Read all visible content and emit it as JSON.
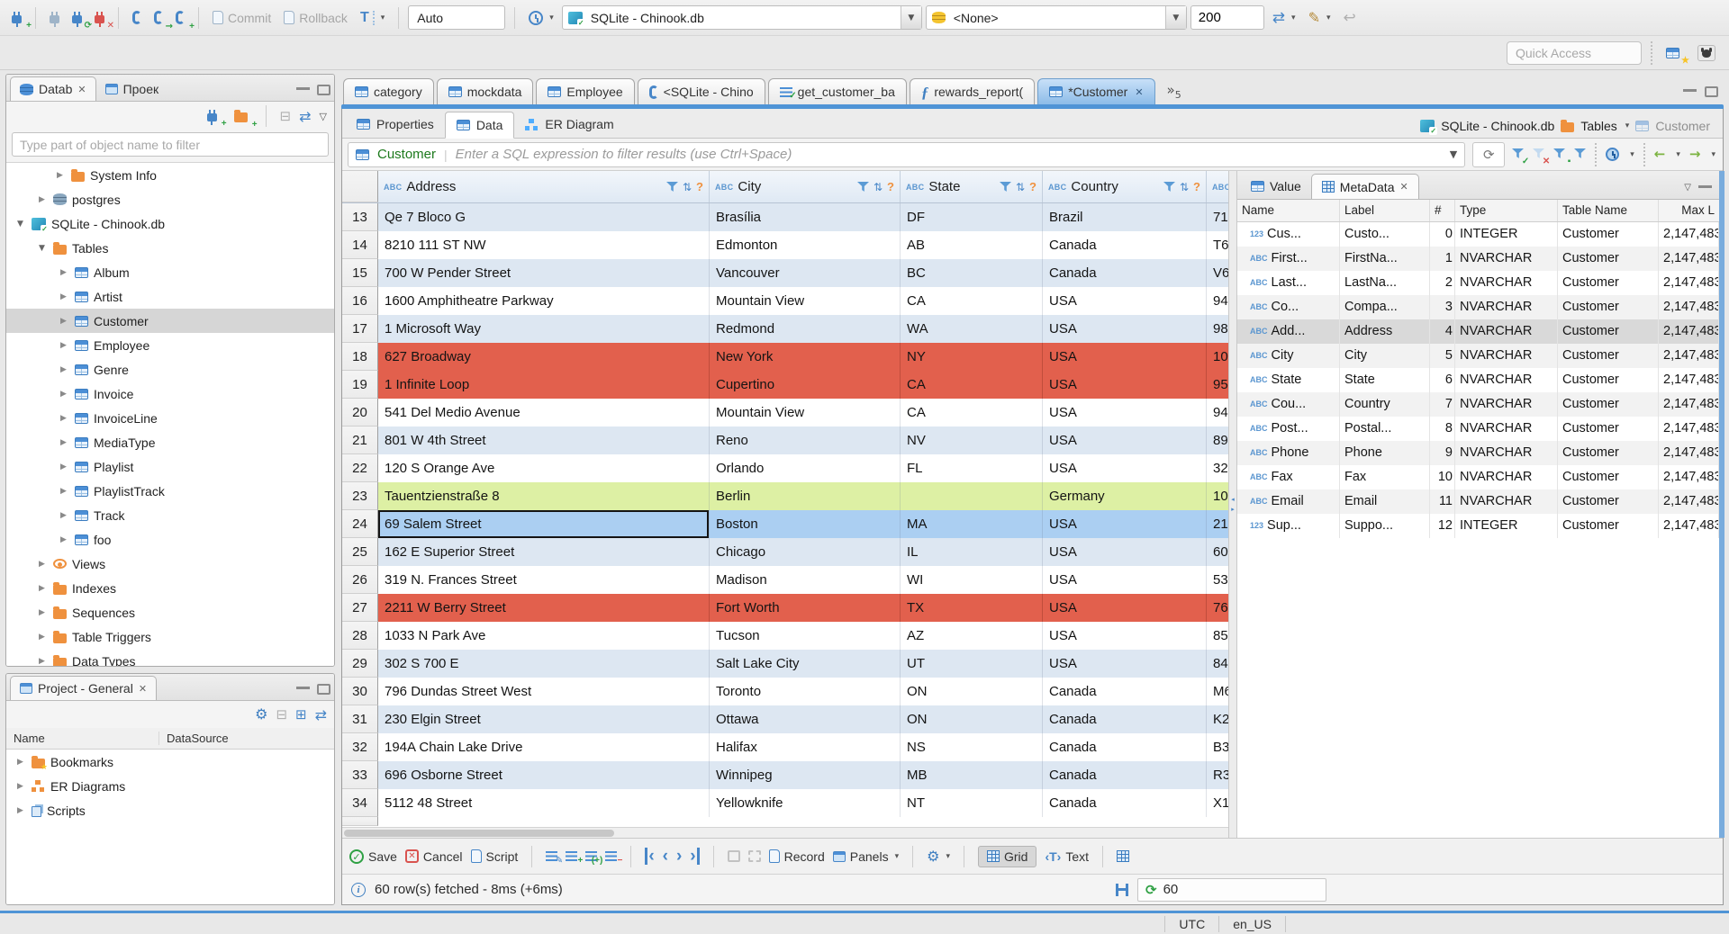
{
  "colors": {
    "accent": "#4f94d6",
    "row_red": "#e2604d",
    "row_green": "#ddf0a4",
    "row_selected": "#abcff2",
    "row_stripe": "#dde7f2"
  },
  "window": {
    "quick_access_placeholder": "Quick Access"
  },
  "toolbar": {
    "commit_label": "Commit",
    "rollback_label": "Rollback",
    "txn_mode": "Auto",
    "connection": "SQLite - Chinook.db",
    "database": "<None>",
    "fetch_size": "200"
  },
  "editor_tabs": [
    {
      "label": "category",
      "icon": "table"
    },
    {
      "label": "mockdata",
      "icon": "table"
    },
    {
      "label": "Employee",
      "icon": "table"
    },
    {
      "label": "<SQLite - Chino",
      "icon": "sql"
    },
    {
      "label": "get_customer_ba",
      "icon": "script"
    },
    {
      "label": "rewards_report(",
      "icon": "fn"
    },
    {
      "label": "*Customer",
      "icon": "table",
      "active": true,
      "closable": true
    }
  ],
  "editor_tab_overflow": "5",
  "navigator": {
    "tab_database": "Datab",
    "tab_projects": "Проек",
    "filter_placeholder": "Type part of object name to filter",
    "tree": [
      {
        "label": "System Info",
        "icon": "folder",
        "indent": 56,
        "arrow": "r"
      },
      {
        "label": "postgres",
        "icon": "db",
        "indent": 36,
        "arrow": "r"
      },
      {
        "label": "SQLite - Chinook.db",
        "icon": "sqlite",
        "indent": 12,
        "arrow": "d"
      },
      {
        "label": "Tables",
        "icon": "folder",
        "indent": 36,
        "arrow": "d"
      },
      {
        "label": "Album",
        "icon": "table",
        "indent": 60,
        "arrow": "r"
      },
      {
        "label": "Artist",
        "icon": "table",
        "indent": 60,
        "arrow": "r"
      },
      {
        "label": "Customer",
        "icon": "table",
        "indent": 60,
        "arrow": "r",
        "selected": true
      },
      {
        "label": "Employee",
        "icon": "table",
        "indent": 60,
        "arrow": "r"
      },
      {
        "label": "Genre",
        "icon": "table",
        "indent": 60,
        "arrow": "r"
      },
      {
        "label": "Invoice",
        "icon": "table",
        "indent": 60,
        "arrow": "r"
      },
      {
        "label": "InvoiceLine",
        "icon": "table",
        "indent": 60,
        "arrow": "r"
      },
      {
        "label": "MediaType",
        "icon": "table",
        "indent": 60,
        "arrow": "r"
      },
      {
        "label": "Playlist",
        "icon": "table",
        "indent": 60,
        "arrow": "r"
      },
      {
        "label": "PlaylistTrack",
        "icon": "table",
        "indent": 60,
        "arrow": "r"
      },
      {
        "label": "Track",
        "icon": "table",
        "indent": 60,
        "arrow": "r"
      },
      {
        "label": "foo",
        "icon": "table",
        "indent": 60,
        "arrow": "r"
      },
      {
        "label": "Views",
        "icon": "eye",
        "indent": 36,
        "arrow": "r"
      },
      {
        "label": "Indexes",
        "icon": "folder",
        "indent": 36,
        "arrow": "r"
      },
      {
        "label": "Sequences",
        "icon": "folder",
        "indent": 36,
        "arrow": "r"
      },
      {
        "label": "Table Triggers",
        "icon": "folder",
        "indent": 36,
        "arrow": "r"
      },
      {
        "label": "Data Types",
        "icon": "folder",
        "indent": 36,
        "arrow": "r"
      }
    ]
  },
  "project_panel": {
    "title": "Project - General",
    "columns": {
      "name": "Name",
      "datasource": "DataSource"
    },
    "items": [
      {
        "label": "Bookmarks",
        "icon": "folder-star"
      },
      {
        "label": "ER Diagrams",
        "icon": "er"
      },
      {
        "label": "Scripts",
        "icon": "scripts"
      }
    ]
  },
  "result_tabs": {
    "properties": "Properties",
    "data": "Data",
    "er": "ER Diagram"
  },
  "breadcrumb": {
    "connection": "SQLite - Chinook.db",
    "tables": "Tables",
    "entity": "Customer"
  },
  "filter_bar": {
    "entity": "Customer",
    "placeholder": "Enter a SQL expression to filter results (use Ctrl+Space)"
  },
  "grid": {
    "columns": [
      "Address",
      "City",
      "State",
      "Country"
    ],
    "rows": [
      {
        "num": "13",
        "address": "Qe 7 Bloco G",
        "city": "Brasília",
        "state": "DF",
        "country": "Brazil",
        "postal": "71",
        "bg": "stripe"
      },
      {
        "num": "14",
        "address": "8210 111 ST NW",
        "city": "Edmonton",
        "state": "AB",
        "country": "Canada",
        "postal": "T6",
        "bg": "white"
      },
      {
        "num": "15",
        "address": "700 W Pender Street",
        "city": "Vancouver",
        "state": "BC",
        "country": "Canada",
        "postal": "V6",
        "bg": "stripe"
      },
      {
        "num": "16",
        "address": "1600 Amphitheatre Parkway",
        "city": "Mountain View",
        "state": "CA",
        "country": "USA",
        "postal": "94",
        "bg": "white"
      },
      {
        "num": "17",
        "address": "1 Microsoft Way",
        "city": "Redmond",
        "state": "WA",
        "country": "USA",
        "postal": "98",
        "bg": "stripe"
      },
      {
        "num": "18",
        "address": "627 Broadway",
        "city": "New York",
        "state": "NY",
        "country": "USA",
        "postal": "10",
        "bg": "red"
      },
      {
        "num": "19",
        "address": "1 Infinite Loop",
        "city": "Cupertino",
        "state": "CA",
        "country": "USA",
        "postal": "95",
        "bg": "red"
      },
      {
        "num": "20",
        "address": "541 Del Medio Avenue",
        "city": "Mountain View",
        "state": "CA",
        "country": "USA",
        "postal": "94",
        "bg": "white"
      },
      {
        "num": "21",
        "address": "801 W 4th Street",
        "city": "Reno",
        "state": "NV",
        "country": "USA",
        "postal": "89",
        "bg": "stripe"
      },
      {
        "num": "22",
        "address": "120 S Orange Ave",
        "city": "Orlando",
        "state": "FL",
        "country": "USA",
        "postal": "32",
        "bg": "white"
      },
      {
        "num": "23",
        "address": "Tauentzienstraße 8",
        "city": "Berlin",
        "state": "",
        "country": "Germany",
        "postal": "10",
        "bg": "green"
      },
      {
        "num": "24",
        "address": "69 Salem Street",
        "city": "Boston",
        "state": "MA",
        "country": "USA",
        "postal": "21",
        "bg": "selected",
        "focused": true
      },
      {
        "num": "25",
        "address": "162 E Superior Street",
        "city": "Chicago",
        "state": "IL",
        "country": "USA",
        "postal": "60",
        "bg": "stripe"
      },
      {
        "num": "26",
        "address": "319 N. Frances Street",
        "city": "Madison",
        "state": "WI",
        "country": "USA",
        "postal": "53",
        "bg": "white"
      },
      {
        "num": "27",
        "address": "2211 W Berry Street",
        "city": "Fort Worth",
        "state": "TX",
        "country": "USA",
        "postal": "76",
        "bg": "red"
      },
      {
        "num": "28",
        "address": "1033 N Park Ave",
        "city": "Tucson",
        "state": "AZ",
        "country": "USA",
        "postal": "85",
        "bg": "white"
      },
      {
        "num": "29",
        "address": "302 S 700 E",
        "city": "Salt Lake City",
        "state": "UT",
        "country": "USA",
        "postal": "84",
        "bg": "stripe"
      },
      {
        "num": "30",
        "address": "796 Dundas Street West",
        "city": "Toronto",
        "state": "ON",
        "country": "Canada",
        "postal": "M6",
        "bg": "white"
      },
      {
        "num": "31",
        "address": "230 Elgin Street",
        "city": "Ottawa",
        "state": "ON",
        "country": "Canada",
        "postal": "K2",
        "bg": "stripe"
      },
      {
        "num": "32",
        "address": "194A Chain Lake Drive",
        "city": "Halifax",
        "state": "NS",
        "country": "Canada",
        "postal": "B3",
        "bg": "white"
      },
      {
        "num": "33",
        "address": "696 Osborne Street",
        "city": "Winnipeg",
        "state": "MB",
        "country": "Canada",
        "postal": "R3",
        "bg": "stripe"
      },
      {
        "num": "34",
        "address": "5112 48 Street",
        "city": "Yellowknife",
        "state": "NT",
        "country": "Canada",
        "postal": "X1",
        "bg": "white"
      }
    ]
  },
  "meta_panel": {
    "tab_value": "Value",
    "tab_metadata": "MetaData",
    "columns": [
      "Name",
      "Label",
      "#",
      "Type",
      "Table Name",
      "Max L"
    ],
    "rows": [
      {
        "icon": "123",
        "name": "Cus...",
        "label": "Custo...",
        "num": "0",
        "type": "INTEGER",
        "table": "Customer",
        "max": "2,147,483"
      },
      {
        "icon": "abc",
        "name": "First...",
        "label": "FirstNa...",
        "num": "1",
        "type": "NVARCHAR",
        "table": "Customer",
        "max": "2,147,483"
      },
      {
        "icon": "abc",
        "name": "Last...",
        "label": "LastNa...",
        "num": "2",
        "type": "NVARCHAR",
        "table": "Customer",
        "max": "2,147,483"
      },
      {
        "icon": "abc",
        "name": "Co...",
        "label": "Compa...",
        "num": "3",
        "type": "NVARCHAR",
        "table": "Customer",
        "max": "2,147,483"
      },
      {
        "icon": "abc",
        "name": "Add...",
        "label": "Address",
        "num": "4",
        "type": "NVARCHAR",
        "table": "Customer",
        "max": "2,147,483",
        "selected": true
      },
      {
        "icon": "abc",
        "name": "City",
        "label": "City",
        "num": "5",
        "type": "NVARCHAR",
        "table": "Customer",
        "max": "2,147,483"
      },
      {
        "icon": "abc",
        "name": "State",
        "label": "State",
        "num": "6",
        "type": "NVARCHAR",
        "table": "Customer",
        "max": "2,147,483"
      },
      {
        "icon": "abc",
        "name": "Cou...",
        "label": "Country",
        "num": "7",
        "type": "NVARCHAR",
        "table": "Customer",
        "max": "2,147,483"
      },
      {
        "icon": "abc",
        "name": "Post...",
        "label": "Postal...",
        "num": "8",
        "type": "NVARCHAR",
        "table": "Customer",
        "max": "2,147,483"
      },
      {
        "icon": "abc",
        "name": "Phone",
        "label": "Phone",
        "num": "9",
        "type": "NVARCHAR",
        "table": "Customer",
        "max": "2,147,483"
      },
      {
        "icon": "abc",
        "name": "Fax",
        "label": "Fax",
        "num": "10",
        "type": "NVARCHAR",
        "table": "Customer",
        "max": "2,147,483"
      },
      {
        "icon": "abc",
        "name": "Email",
        "label": "Email",
        "num": "11",
        "type": "NVARCHAR",
        "table": "Customer",
        "max": "2,147,483"
      },
      {
        "icon": "123",
        "name": "Sup...",
        "label": "Suppo...",
        "num": "12",
        "type": "INTEGER",
        "table": "Customer",
        "max": "2,147,483"
      }
    ]
  },
  "bottom_toolbar": {
    "save": "Save",
    "cancel": "Cancel",
    "script": "Script",
    "record": "Record",
    "panels": "Panels",
    "grid": "Grid",
    "text": "Text"
  },
  "status": {
    "message": "60 row(s) fetched - 8ms (+6ms)",
    "auto_refresh": "60"
  },
  "footer": {
    "timezone": "UTC",
    "locale": "en_US"
  }
}
